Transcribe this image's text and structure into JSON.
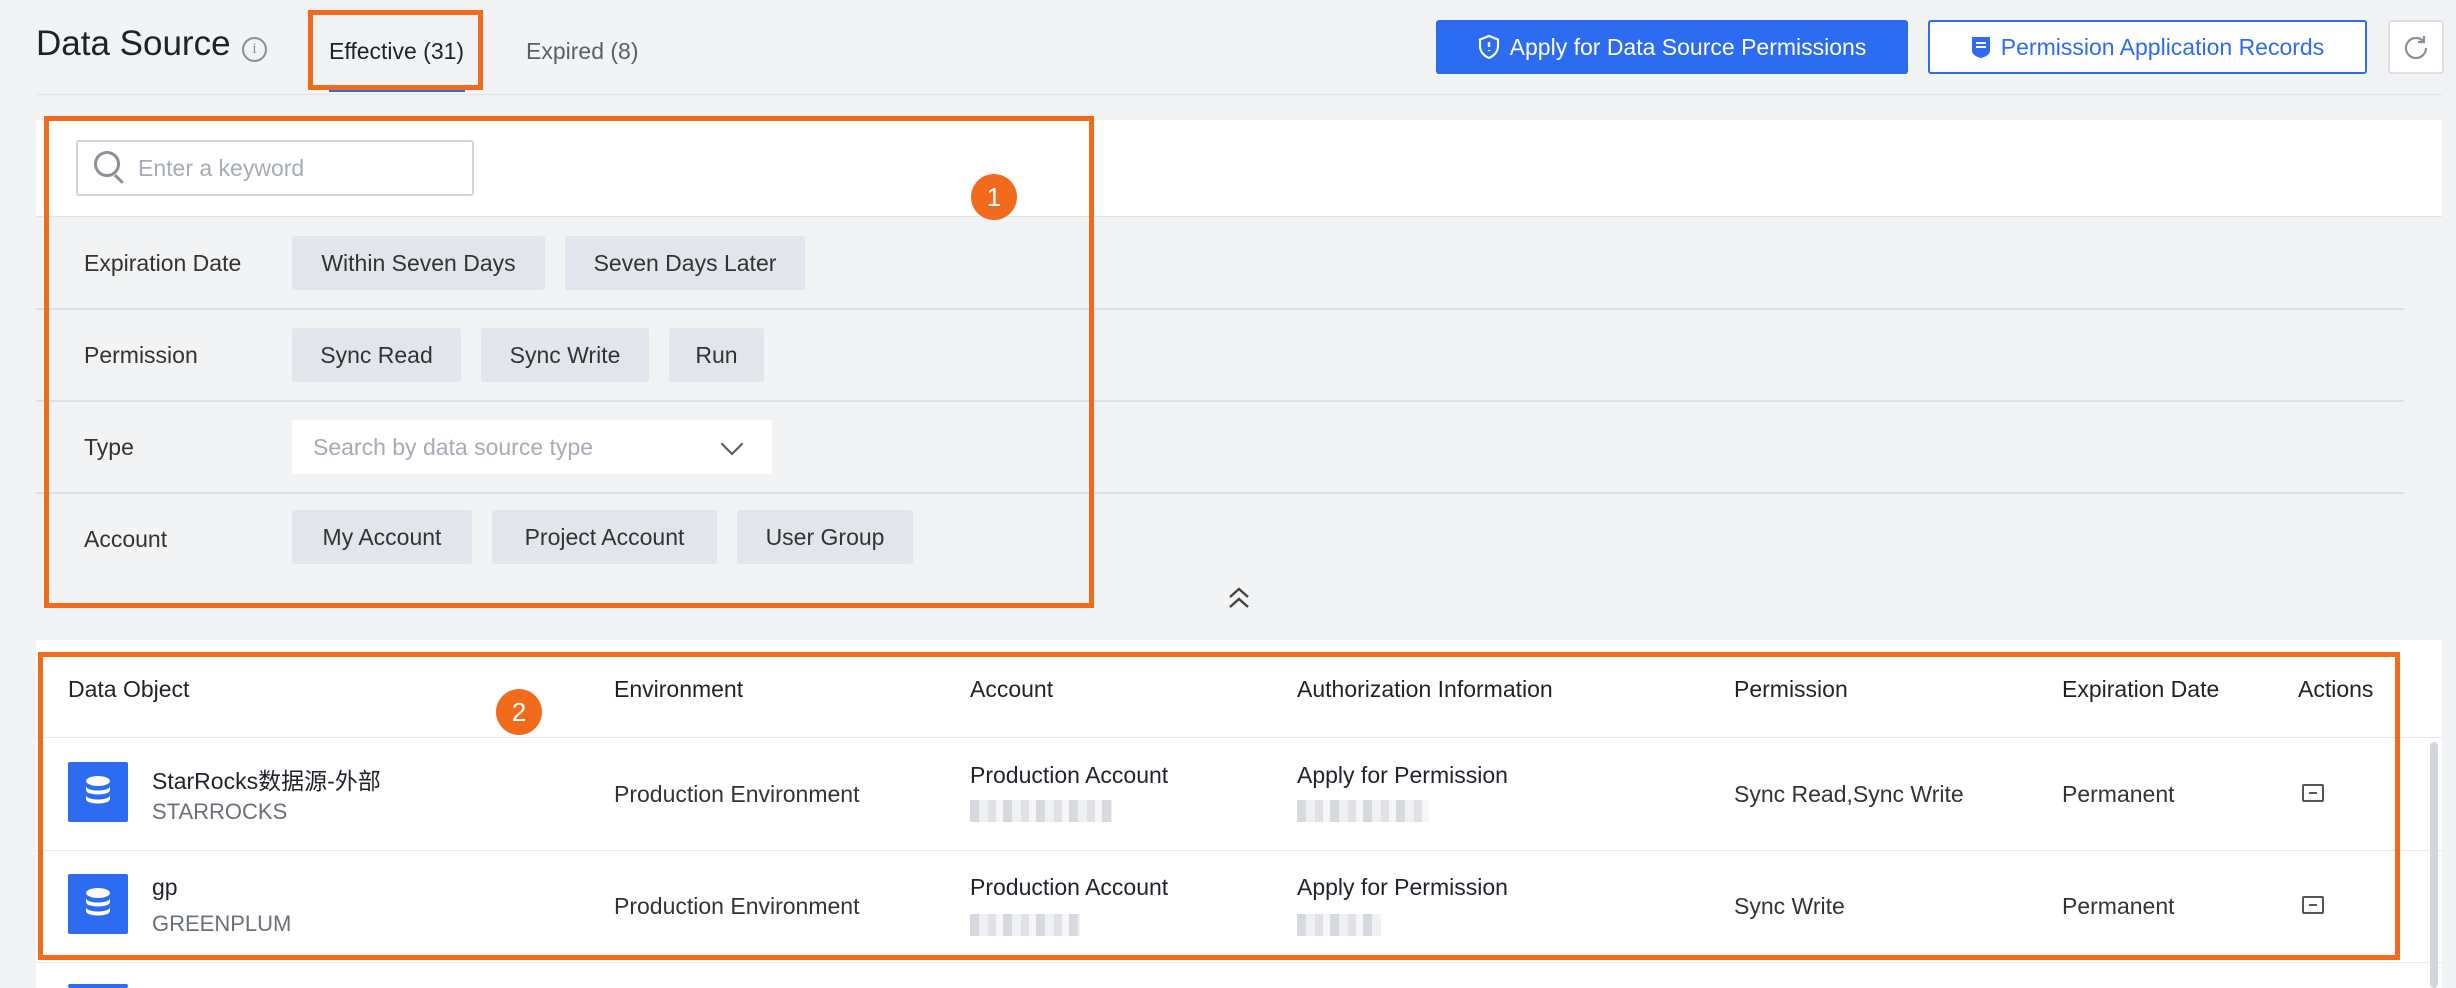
{
  "header": {
    "title": "Data Source",
    "info_icon": "info-icon",
    "tabs": [
      {
        "label": "Effective (31)"
      },
      {
        "label": "Expired (8)"
      }
    ],
    "apply_button": "Apply for Data Source Permissions",
    "records_button": "Permission Application Records"
  },
  "filters": {
    "search_placeholder": "Enter a keyword",
    "expiration_label": "Expiration Date",
    "expiration_options": [
      "Within Seven Days",
      "Seven Days Later"
    ],
    "permission_label": "Permission",
    "permission_options": [
      "Sync Read",
      "Sync Write",
      "Run"
    ],
    "type_label": "Type",
    "type_placeholder": "Search by data source type",
    "account_label": "Account",
    "account_options": [
      "My Account",
      "Project Account",
      "User Group"
    ]
  },
  "table": {
    "columns": [
      "Data Object",
      "Environment",
      "Account",
      "Authorization Information",
      "Permission",
      "Expiration Date",
      "Actions"
    ],
    "rows": [
      {
        "name": "StarRocks数据源-外部",
        "type": "STARROCKS",
        "environment": "Production Environment",
        "account": "Production Account",
        "authorization": "Apply for Permission",
        "permission": "Sync Read,Sync Write",
        "expiration": "Permanent"
      },
      {
        "name": "gp",
        "type": "GREENPLUM",
        "environment": "Production Environment",
        "account": "Production Account",
        "authorization": "Apply for Permission",
        "permission": "Sync Write",
        "expiration": "Permanent"
      }
    ]
  },
  "annotations": {
    "badge_1": "1",
    "badge_2": "2",
    "highlight_color": "#f26b1d"
  },
  "colors": {
    "primary": "#2c6cf0",
    "annotation": "#f26b1d"
  }
}
